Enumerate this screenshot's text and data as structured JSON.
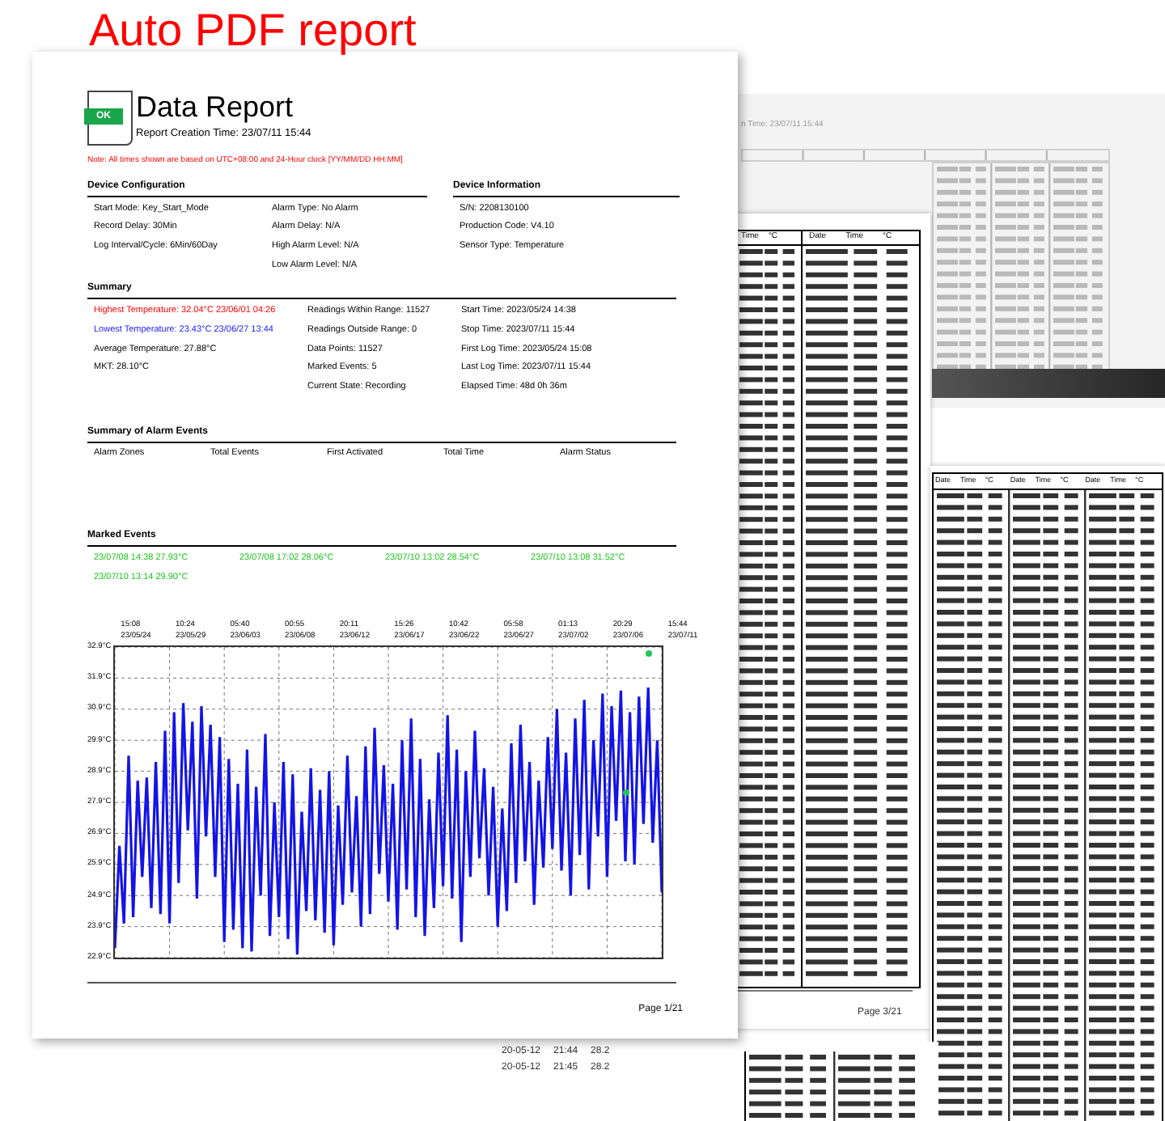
{
  "title": "Auto PDF report",
  "report": {
    "badge": "OK",
    "heading": "Data Report",
    "creation_time": "Report Creation Time: 23/07/11 15:44",
    "note": "Note: All times shown are based on UTC+08:00 and 24-Hour clock [YY/MM/DD HH:MM]",
    "device_configuration": {
      "title": "Device Configuration",
      "column_1": [
        "Start Mode: Key_Start_Mode",
        "Record Delay: 30Min",
        "Log Interval/Cycle: 6Min/60Day"
      ],
      "column_2": [
        "Alarm Type: No Alarm",
        "Alarm Delay: N/A",
        "High Alarm Level: N/A",
        "Low Alarm Level: N/A"
      ]
    },
    "device_information": {
      "title": "Device Information",
      "items": [
        "S/N: 2208130100",
        "Production Code: V4.10",
        "Sensor Type: Temperature"
      ]
    },
    "summary": {
      "title": "Summary",
      "column_1": [
        {
          "text": "Highest Temperature: 32.04°C  23/06/01 04:26",
          "kind": "high"
        },
        {
          "text": "Lowest Temperature: 23.43°C  23/06/27 13:44",
          "kind": "low"
        },
        {
          "text": "Average Temperature: 27.88°C",
          "kind": "normal"
        },
        {
          "text": "MKT: 28.10°C",
          "kind": "normal"
        }
      ],
      "column_2": [
        "Readings Within Range: 11527",
        "Readings Outside Range: 0",
        "Data Points: 11527",
        "Marked Events: 5",
        "Current State: Recording"
      ],
      "column_3": [
        "Start Time: 2023/05/24 14:38",
        "Stop Time: 2023/07/11 15:44",
        "First Log Time: 2023/05/24 15:08",
        "Last Log Time: 2023/07/11 15:44",
        "Elapsed Time: 48d 0h 36m"
      ]
    },
    "alarm_events": {
      "title": "Summary of Alarm Events",
      "columns": [
        "Alarm Zones",
        "Total Events",
        "First Activated",
        "Total Time",
        "Alarm Status"
      ]
    },
    "marked_events": {
      "title": "Marked Events",
      "items": [
        "23/07/08 14:38  27.93°C",
        "23/07/08 17:02  28.06°C",
        "23/07/10 13:02  28.54°C",
        "23/07/10 13:08  31.52°C",
        "23/07/10 13:14  29.90°C"
      ]
    },
    "chart": {
      "x_labels": [
        {
          "time": "15:08",
          "date": "23/05/24"
        },
        {
          "time": "10:24",
          "date": "23/05/29"
        },
        {
          "time": "05:40",
          "date": "23/06/03"
        },
        {
          "time": "00:55",
          "date": "23/06/08"
        },
        {
          "time": "20:11",
          "date": "23/06/12"
        },
        {
          "time": "15:26",
          "date": "23/06/17"
        },
        {
          "time": "10:42",
          "date": "23/06/22"
        },
        {
          "time": "05:58",
          "date": "23/06/27"
        },
        {
          "time": "01:13",
          "date": "23/07/02"
        },
        {
          "time": "20:29",
          "date": "23/07/06"
        },
        {
          "time": "15:44",
          "date": "23/07/11"
        }
      ],
      "chart_data": {
        "type": "line",
        "grid": true,
        "ylim": [
          22.9,
          32.9
        ],
        "yticks": [
          {
            "value": 32.9,
            "label": "32.9°C"
          },
          {
            "value": 31.9,
            "label": "31.9°C"
          },
          {
            "value": 30.9,
            "label": "30.9°C"
          },
          {
            "value": 29.9,
            "label": "29.9°C"
          },
          {
            "value": 28.9,
            "label": "28.9°C"
          },
          {
            "value": 27.9,
            "label": "27.9°C"
          },
          {
            "value": 26.9,
            "label": "26.9°C"
          },
          {
            "value": 25.9,
            "label": "25.9°C"
          },
          {
            "value": 24.9,
            "label": "24.9°C"
          },
          {
            "value": 23.9,
            "label": "23.9°C"
          },
          {
            "value": 22.9,
            "label": "22.9°C"
          }
        ],
        "series": [
          {
            "color": "#1414e6",
            "values": [
              23.2,
              26.5,
              24,
              29.4,
              24.2,
              28.6,
              25.5,
              28.7,
              24.5,
              29.2,
              24.3,
              30.2,
              24,
              30.8,
              25.3,
              31.1,
              27,
              30.5,
              24.8,
              31,
              26.8,
              30.4,
              25.5,
              30,
              23.4,
              29.3,
              23.8,
              28.5,
              23.2,
              29.6,
              23.1,
              28.4,
              24.9,
              30.1,
              23.6,
              27.9,
              24.2,
              29.2,
              23.5,
              28.8,
              23.0,
              27.6,
              24.4,
              29.0,
              24.1,
              28.3,
              23.7,
              28.9,
              23.3,
              27.8,
              24.6,
              29.4,
              25.0,
              28.1,
              23.9,
              29.7,
              24.3,
              30.3,
              25.6,
              29.1,
              24.7,
              28.5,
              23.8,
              29.9,
              25.1,
              30.6,
              24.2,
              29.3,
              23.6,
              28.0,
              24.5,
              29.5,
              25.2,
              30.7,
              24.8,
              29.6,
              23.4,
              28.9,
              25.5,
              30.2,
              26.1,
              29.0,
              24.9,
              28.4,
              23.9,
              27.7,
              24.4,
              29.8,
              25.3,
              30.4,
              26.0,
              29.2,
              24.6,
              28.6,
              25.8,
              30.0,
              26.4,
              30.9,
              25.7,
              29.5,
              24.9,
              30.6,
              26.2,
              31.2,
              25.1,
              29.9,
              26.8,
              31.4,
              25.5,
              31.0,
              27.3,
              31.5,
              26.0,
              30.8,
              25.9,
              31.3,
              27.2,
              31.6,
              26.6,
              29.9,
              25.0
            ]
          }
        ]
      }
    },
    "page_label": "Page 1/21"
  },
  "back_pages": {
    "faded_page": {
      "creation_time": "n Time: 23/07/11 15:44"
    },
    "middle_page": {
      "headers": [
        "Time",
        "°C",
        "Date",
        "Time",
        "°C"
      ],
      "page_label": "Page 3/21"
    },
    "right_page": {
      "headers": [
        "Date",
        "Time",
        "°C",
        "Date",
        "Time",
        "°C",
        "Date",
        "Time",
        "°C"
      ]
    },
    "bottom_strip": [
      {
        "date": "20-05-12",
        "time": "21:44",
        "value": "28.2"
      },
      {
        "date": "20-05-12",
        "time": "21:45",
        "value": "28.2"
      }
    ]
  }
}
